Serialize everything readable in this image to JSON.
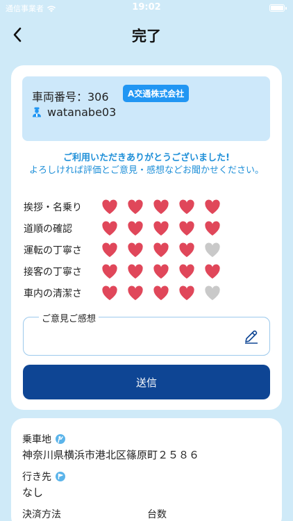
{
  "status_bar": {
    "carrier": "通信事業者",
    "time": "19:02"
  },
  "nav": {
    "title": "完了"
  },
  "vehicle": {
    "number_text": "車両番号：306",
    "company": "A交通株式会社",
    "driver_id": "watanabe03"
  },
  "messages": {
    "thanks": "ご利用いただきありがとうございました!",
    "request": "よろしければ評価とご意見・感想などお聞かせください。"
  },
  "ratings": [
    {
      "label": "挨拶・名乗り",
      "score": 5,
      "max": 5
    },
    {
      "label": "道順の確認",
      "score": 5,
      "max": 5
    },
    {
      "label": "運転の丁寧さ",
      "score": 4,
      "max": 5
    },
    {
      "label": "接客の丁寧さ",
      "score": 5,
      "max": 5
    },
    {
      "label": "車内の清潔さ",
      "score": 4,
      "max": 5
    }
  ],
  "comment": {
    "label": "ご意見ご感想",
    "value": ""
  },
  "submit": {
    "label": "送信"
  },
  "trip": {
    "pickup_label": "乗車地",
    "pickup_value": "神奈川県横浜市港北区篠原町２５８６",
    "destination_label": "行き先",
    "destination_value": "なし",
    "payment_label": "決済方法",
    "count_label": "台数"
  },
  "colors": {
    "background": "#cfeaf8",
    "accent": "#1e8fd8",
    "badge": "#2196f3",
    "submit": "#0e4594",
    "heart_on": "#e0475a",
    "heart_off": "#c9c9c9"
  }
}
